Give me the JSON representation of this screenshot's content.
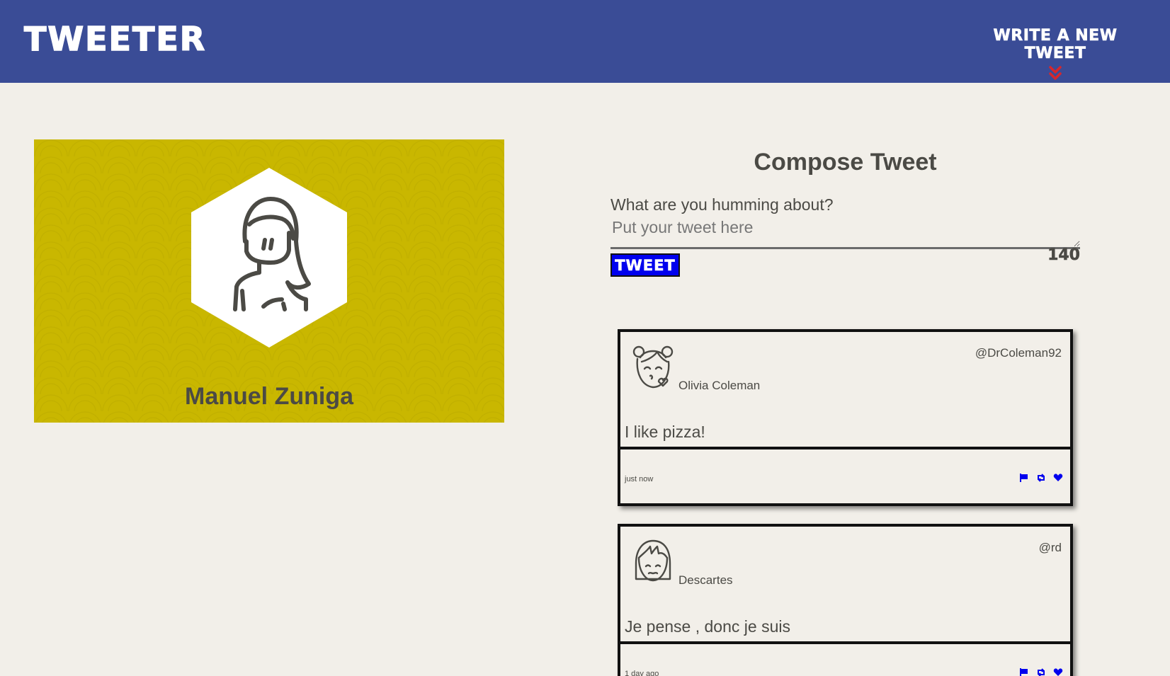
{
  "nav": {
    "brand": "TWEETER",
    "write_new_label": "WRITE A NEW TWEET",
    "write_new_icon": "chevron-double-down-icon",
    "accent": "#d7262b",
    "bg": "#3a4c96"
  },
  "profile": {
    "name": "Manuel Zuniga",
    "bg": "#c9b700"
  },
  "compose": {
    "title": "Compose Tweet",
    "question": "What are you humming about?",
    "placeholder": "Put your tweet here",
    "button_label": "TWEET",
    "counter": "140"
  },
  "tweets": [
    {
      "name": "Olivia Coleman",
      "handle": "@DrColeman92",
      "text": "I like pizza!",
      "time": "just now"
    },
    {
      "name": "Descartes",
      "handle": "@rd",
      "text": "Je pense , donc je suis",
      "time": "1 day ago"
    }
  ],
  "actions": {
    "flag_icon": "flag-icon",
    "retweet_icon": "retweet-icon",
    "like_icon": "heart-icon",
    "color": "#0000ee"
  }
}
